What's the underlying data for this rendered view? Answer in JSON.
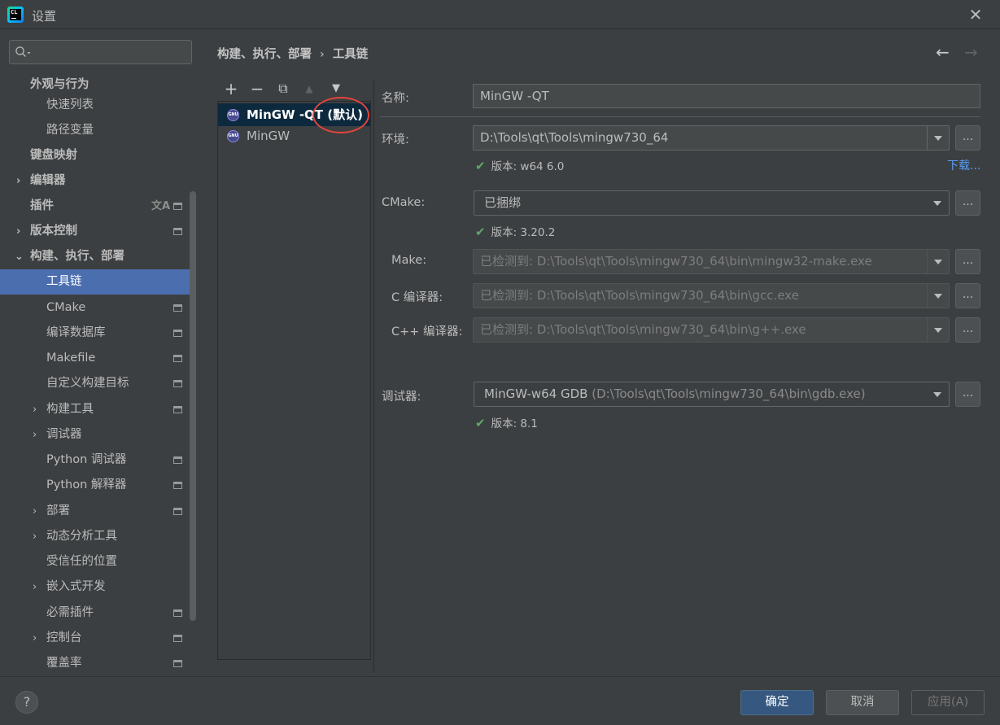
{
  "window": {
    "title": "设置",
    "app_icon_text": "CL"
  },
  "sidebar": {
    "search_placeholder": "",
    "items": [
      {
        "label": "外观与行为",
        "bold": true
      },
      {
        "label": "快速列表"
      },
      {
        "label": "路径变量"
      },
      {
        "label": "键盘映射",
        "bold": true
      },
      {
        "label": "编辑器",
        "bold": true
      },
      {
        "label": "插件",
        "bold": true
      },
      {
        "label": "版本控制",
        "bold": true
      },
      {
        "label": "构建、执行、部署",
        "bold": true
      },
      {
        "label": "工具链"
      },
      {
        "label": "CMake"
      },
      {
        "label": "编译数据库"
      },
      {
        "label": "Makefile"
      },
      {
        "label": "自定义构建目标"
      },
      {
        "label": "构建工具"
      },
      {
        "label": "调试器"
      },
      {
        "label": "Python 调试器"
      },
      {
        "label": "Python 解释器"
      },
      {
        "label": "部署"
      },
      {
        "label": "动态分析工具"
      },
      {
        "label": "受信任的位置"
      },
      {
        "label": "嵌入式开发"
      },
      {
        "label": "必需插件"
      },
      {
        "label": "控制台"
      },
      {
        "label": "覆盖率"
      }
    ],
    "selected": "工具链"
  },
  "breadcrumb": {
    "parent": "构建、执行、部署",
    "sep": "›",
    "current": "工具链"
  },
  "toolbar": {
    "add": "+",
    "remove": "−",
    "copy": "⧉",
    "up": "▲",
    "down": "▼"
  },
  "toolchains": {
    "items": [
      {
        "name": "MinGW -QT",
        "default_tag": "(默认)",
        "icon_text": "GNU"
      },
      {
        "name": "MinGW",
        "default_tag": "",
        "icon_text": "GNU"
      }
    ]
  },
  "form": {
    "name_label": "名称:",
    "name_value": "MinGW -QT",
    "env_label": "环境:",
    "env_value": "D:\\Tools\\qt\\Tools\\mingw730_64",
    "env_version": "版本: w64 6.0",
    "download_link": "下载...",
    "cmake_label": "CMake:",
    "cmake_value": "已捆绑",
    "cmake_version": "版本: 3.20.2",
    "make_label": "Make:",
    "make_value": "已检测到: D:\\Tools\\qt\\Tools\\mingw730_64\\bin\\mingw32-make.exe",
    "c_label": "C 编译器:",
    "c_value": "已检测到: D:\\Tools\\qt\\Tools\\mingw730_64\\bin\\gcc.exe",
    "cpp_label": "C++ 编译器:",
    "cpp_value": "已检测到: D:\\Tools\\qt\\Tools\\mingw730_64\\bin\\g++.exe",
    "debugger_label": "调试器:",
    "debugger_name": "MinGW-w64 GDB",
    "debugger_path": "(D:\\Tools\\qt\\Tools\\mingw730_64\\bin\\gdb.exe)",
    "debugger_version": "版本: 8.1",
    "ellipsis": "..."
  },
  "footer": {
    "help": "?",
    "ok": "确定",
    "cancel": "取消",
    "apply": "应用(A)"
  },
  "colors": {
    "selection": "#4b6eaf",
    "list_selection": "#0d293e",
    "check": "#5fa866",
    "link": "#589df6",
    "annotation": "#e2453c"
  }
}
